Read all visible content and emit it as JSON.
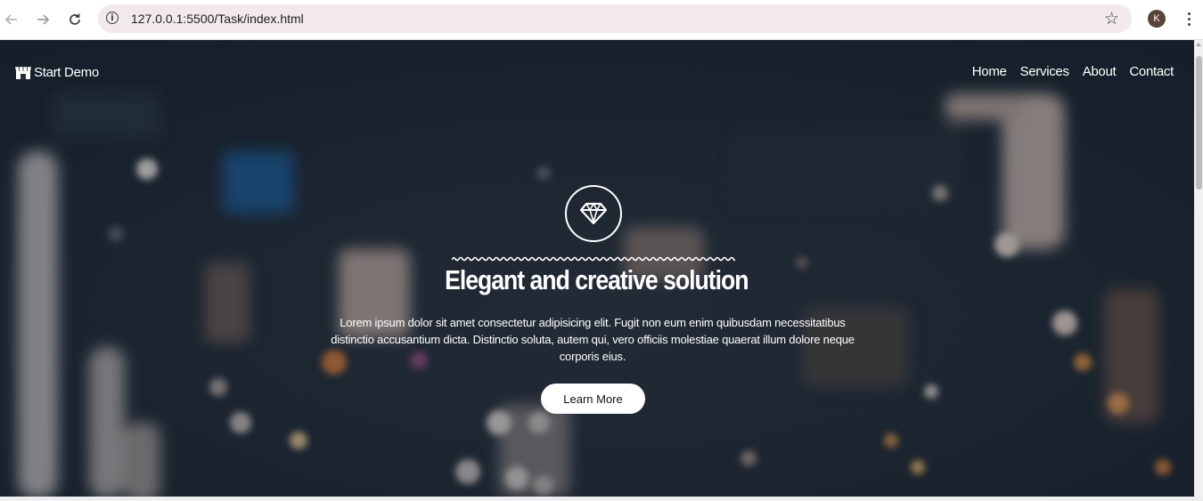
{
  "browser": {
    "url": "127.0.0.1:5500/Task/index.html",
    "avatar_letter": "K",
    "icons": {
      "back": "arrow-back-icon",
      "forward": "arrow-forward-icon",
      "reload": "reload-icon",
      "site_info": "info-icon",
      "bookmark": "star-icon",
      "menu": "kebab-menu-icon"
    }
  },
  "page": {
    "brand": {
      "label": "Start Demo",
      "icon": "store-icon"
    },
    "nav": [
      "Home",
      "Services",
      "About",
      "Contact"
    ],
    "hero": {
      "icon": "diamond-icon",
      "title": "Elegant and creative solution",
      "text": "Lorem ipsum dolor sit amet consectetur adipisicing elit. Fugit non eum enim quibusdam necessitatibus distinctio accusantium dicta. Distinctio soluta, autem qui, vero officiis molestiae quaerat illum dolore neque corporis eius.",
      "button": "Learn More"
    },
    "colors": {
      "background": "#1c2733",
      "text": "#ffffff",
      "button_bg": "#ffffff"
    }
  }
}
